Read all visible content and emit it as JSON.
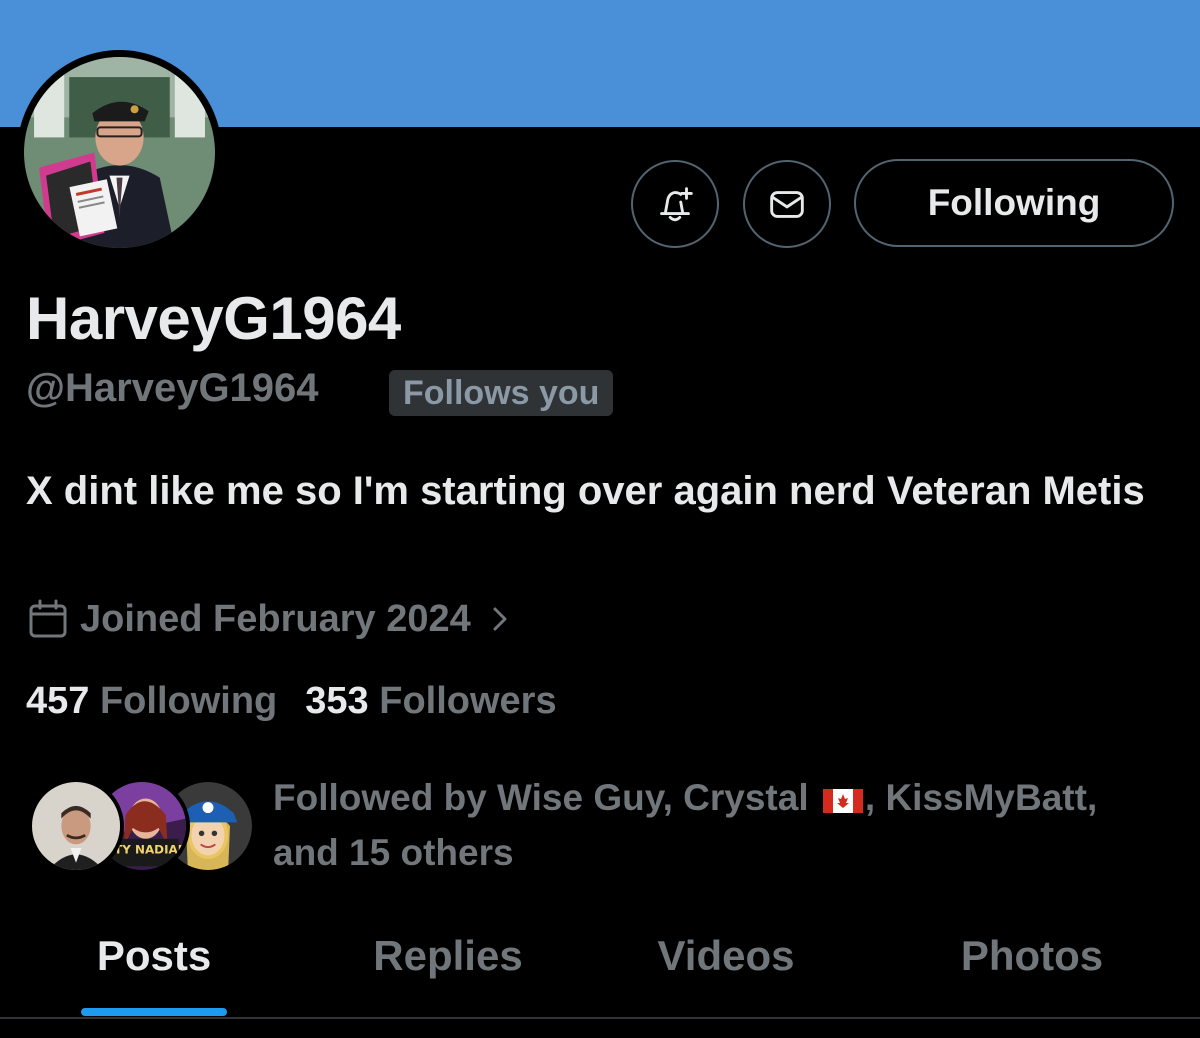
{
  "colors": {
    "banner": "#4a90d9",
    "background": "#000000",
    "primary_text": "#e7e9ea",
    "secondary_text": "#71767b",
    "tab_indicator": "#1d9bf0"
  },
  "profile": {
    "display_name": "HarveyG1964",
    "handle": "@HarveyG1964",
    "follows_you_badge": "Follows you",
    "bio": "X dint like me so I'm starting over again nerd Veteran Metis",
    "joined": "Joined February 2024"
  },
  "actions": {
    "notify_icon": "bell-plus-icon",
    "message_icon": "envelope-icon",
    "following_label": "Following"
  },
  "stats": {
    "following_count": "457",
    "following_label": "Following",
    "followers_count": "353",
    "followers_label": "Followers"
  },
  "followed_by": {
    "prefix": "Followed by Wise Guy, Crystal",
    "suffix": ", KissMyBatt,",
    "rest": "and 15 others",
    "avatar_2_text": "ASTY NADIAN"
  },
  "tabs": [
    {
      "label": "Posts",
      "active": true
    },
    {
      "label": "Replies",
      "active": false
    },
    {
      "label": "Videos",
      "active": false
    },
    {
      "label": "Photos",
      "active": false
    }
  ]
}
